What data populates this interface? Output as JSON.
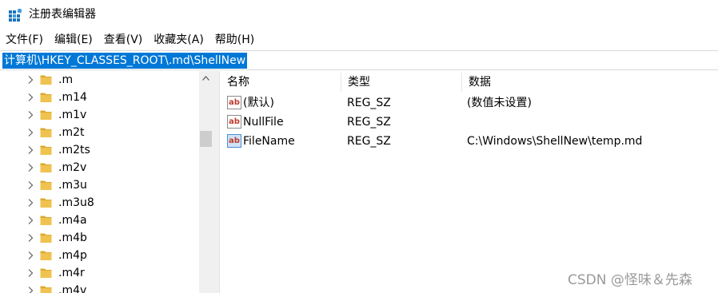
{
  "window": {
    "title": "注册表编辑器"
  },
  "menu": {
    "items": [
      "文件(F)",
      "编辑(E)",
      "查看(V)",
      "收藏夹(A)",
      "帮助(H)"
    ]
  },
  "address": {
    "path": "计算机\\HKEY_CLASSES_ROOT\\.md\\ShellNew"
  },
  "tree": {
    "items": [
      ".m",
      ".m14",
      ".m1v",
      ".m2t",
      ".m2ts",
      ".m2v",
      ".m3u",
      ".m3u8",
      ".m4a",
      ".m4b",
      ".m4p",
      ".m4r",
      ".m4v"
    ]
  },
  "list": {
    "headers": {
      "name": "名称",
      "type": "类型",
      "data": "数据"
    },
    "rows": [
      {
        "name": "(默认)",
        "type": "REG_SZ",
        "data": "(数值未设置)"
      },
      {
        "name": "NullFile",
        "type": "REG_SZ",
        "data": ""
      },
      {
        "name": "FileName",
        "type": "REG_SZ",
        "data": "C:\\Windows\\ShellNew\\temp.md"
      }
    ]
  },
  "watermark": "CSDN @怪味＆先森",
  "colors": {
    "selection": "#0078d7",
    "folder": "#f0c24f",
    "folder_dark": "#dca92e"
  }
}
